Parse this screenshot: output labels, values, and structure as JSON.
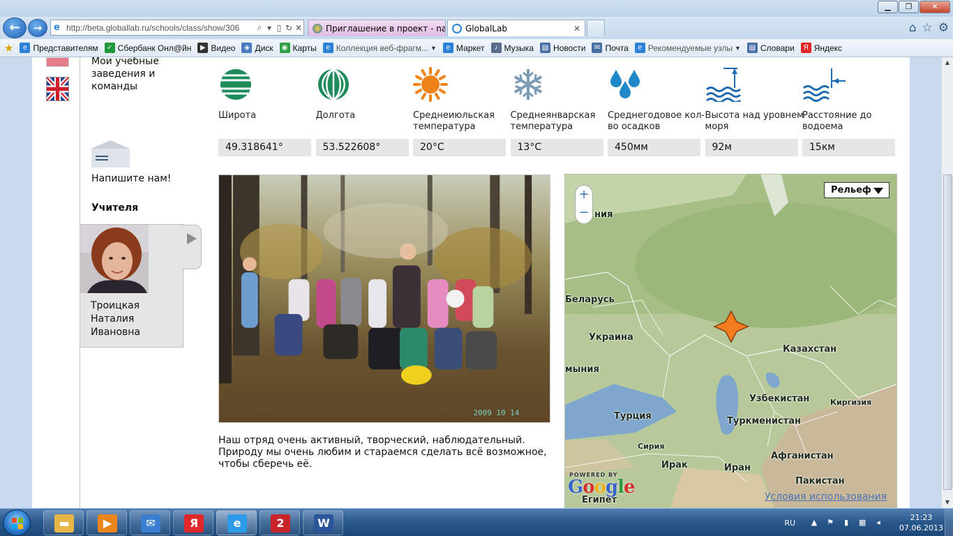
{
  "browser": {
    "address": "http://beta.globallab.ru/schools/class/show/306",
    "tabs": [
      {
        "label": "Приглашение в проект - nat..."
      },
      {
        "label": "GlobalLab"
      }
    ],
    "favorites": [
      {
        "label": "Представителям",
        "icon": "ie-page-icon"
      },
      {
        "label": "Сбербанк Онл@йн",
        "icon": "sber-icon"
      },
      {
        "label": "Видео",
        "icon": "video-icon"
      },
      {
        "label": "Диск",
        "icon": "disk-icon"
      },
      {
        "label": "Карты",
        "icon": "maps-icon"
      },
      {
        "label": "Коллекция веб-фрагм...",
        "icon": "ie-page-icon",
        "dropdown": true,
        "dim": true
      },
      {
        "label": "Маркет",
        "icon": "ie-page-icon"
      },
      {
        "label": "Музыка",
        "icon": "music-icon"
      },
      {
        "label": "Новости",
        "icon": "news-icon"
      },
      {
        "label": "Почта",
        "icon": "mail-icon"
      },
      {
        "label": "Рекомендуемые узлы",
        "icon": "ie-page-icon",
        "dropdown": true,
        "dim": true
      },
      {
        "label": "Словари",
        "icon": "dictionary-icon"
      },
      {
        "label": "Яндекс",
        "icon": "yandex-icon"
      }
    ]
  },
  "sidebar": {
    "institutions": "Мои учебные заведения и команды",
    "write_us": "Напишите нам!",
    "teachers_heading": "Учителя",
    "teacher_name": "Троицкая Наталия Ивановна"
  },
  "params": [
    {
      "label": "Широта",
      "value": "49.318641°",
      "icon": "globe-icon"
    },
    {
      "label": "Долгота",
      "value": "53.522608°",
      "icon": "meridian-icon"
    },
    {
      "label": "Среднеиюльская температура",
      "value": "20°C",
      "icon": "sun-icon"
    },
    {
      "label": "Среднеянварская температура",
      "value": "13°C",
      "icon": "snowflake-icon"
    },
    {
      "label": "Среднегодовое кол-во осадков",
      "value": "450мм",
      "icon": "raindrops-icon"
    },
    {
      "label": "Высота над уровнем моря",
      "value": "92м",
      "icon": "altitude-icon"
    },
    {
      "label": "Расстояние до водоема",
      "value": "15км",
      "icon": "water-distance-icon"
    }
  ],
  "photo": {
    "timestamp": "2009 10 14"
  },
  "description": "Наш отряд очень активный, творческий, наблюдательный. Природу мы очень любим и стараемся сделать всё возможное, чтобы сберечь её.",
  "map": {
    "type_selector": "Рельеф",
    "labels": [
      {
        "text": "Беларусь"
      },
      {
        "text": "Украина"
      },
      {
        "text": "Казахстан"
      },
      {
        "text": "Узбекистан"
      },
      {
        "text": "Киргизия"
      },
      {
        "text": "Туркменистан"
      },
      {
        "text": "Турция"
      },
      {
        "text": "Сирия"
      },
      {
        "text": "Ирак"
      },
      {
        "text": "Иран"
      },
      {
        "text": "Афганистан"
      },
      {
        "text": "Пакистан"
      },
      {
        "text": "Египет"
      },
      {
        "text": "мыния"
      },
      {
        "text": "ния"
      }
    ],
    "powered_by": "POWERED BY",
    "logo": "Google",
    "terms": "Условия использования"
  },
  "taskbar": {
    "apps": [
      {
        "name": "explorer",
        "icon": "folder-icon",
        "color": "#e7b646"
      },
      {
        "name": "media",
        "icon": "media-player-icon",
        "color": "#e9851b"
      },
      {
        "name": "mail",
        "icon": "mail-icon",
        "color": "#3a7fd0"
      },
      {
        "name": "yandex",
        "icon": "yandex-icon",
        "color": "#e0282b",
        "glyph": "Я"
      },
      {
        "name": "ie",
        "icon": "ie-icon",
        "color": "#2c9ae6",
        "glyph": "e",
        "active": true
      },
      {
        "name": "app-red",
        "icon": "app-icon",
        "color": "#c8242a"
      },
      {
        "name": "word",
        "icon": "word-icon",
        "color": "#2a5699",
        "glyph": "W"
      }
    ],
    "lang": "RU",
    "time": "21:23",
    "date": "07.06.2013"
  },
  "colors": {
    "icon_green": "#1f8a5a",
    "icon_orange": "#f08318",
    "icon_steel": "#7c9bb4",
    "icon_blue": "#1e88c8"
  }
}
